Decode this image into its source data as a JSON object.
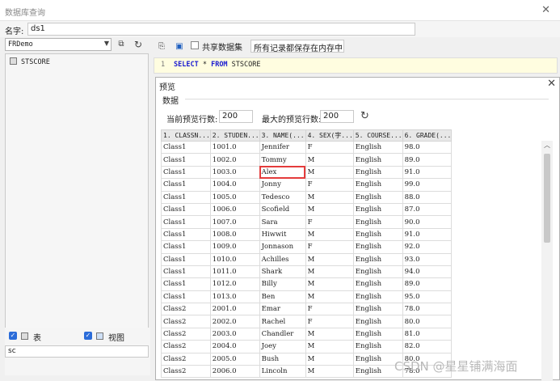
{
  "window": {
    "title": "数据库查询",
    "close": "✕"
  },
  "name_row": {
    "label": "名字:",
    "value": "ds1"
  },
  "left": {
    "db_select": "FRDemo",
    "tables": [
      "STSCORE"
    ],
    "table_checkbox_label": "表",
    "view_checkbox_label": "视图",
    "filter_value": "sc"
  },
  "sql_toolbar": {
    "share_label": "共享数据集",
    "memory_option": "所有记录都保存在内存中"
  },
  "sql": {
    "line_number": "1",
    "keyword_select": "SELECT",
    "star": " * ",
    "keyword_from": "FROM",
    "table": " STSCORE"
  },
  "preview": {
    "title": "预览",
    "tab_label": "数据",
    "row_count_label": "当前预览行数:",
    "row_count_value": "200",
    "max_rows_label": "最大的预览行数:",
    "max_rows_value": "200",
    "columns": [
      "1. CLASSN...",
      "2. STUDEN...",
      "3. NAME(...",
      "4. SEX(字...",
      "5. COURSE...",
      "6. GRADE(..."
    ],
    "rows": [
      [
        "Class1",
        "1001.0",
        "Jennifer",
        "F",
        "English",
        "98.0"
      ],
      [
        "Class1",
        "1002.0",
        "Tommy",
        "M",
        "English",
        "89.0"
      ],
      [
        "Class1",
        "1003.0",
        "Alex",
        "M",
        "English",
        "91.0"
      ],
      [
        "Class1",
        "1004.0",
        "Jonny",
        "F",
        "English",
        "99.0"
      ],
      [
        "Class1",
        "1005.0",
        "Tedesco",
        "M",
        "English",
        "88.0"
      ],
      [
        "Class1",
        "1006.0",
        "Scofield",
        "M",
        "English",
        "87.0"
      ],
      [
        "Class1",
        "1007.0",
        "Sara",
        "F",
        "English",
        "90.0"
      ],
      [
        "Class1",
        "1008.0",
        "Hiwwit",
        "M",
        "English",
        "91.0"
      ],
      [
        "Class1",
        "1009.0",
        "Jonnason",
        "F",
        "English",
        "92.0"
      ],
      [
        "Class1",
        "1010.0",
        "Achilles",
        "M",
        "English",
        "93.0"
      ],
      [
        "Class1",
        "1011.0",
        "Shark",
        "M",
        "English",
        "94.0"
      ],
      [
        "Class1",
        "1012.0",
        "Billy",
        "M",
        "English",
        "89.0"
      ],
      [
        "Class1",
        "1013.0",
        "Ben",
        "M",
        "English",
        "95.0"
      ],
      [
        "Class2",
        "2001.0",
        "Emar",
        "F",
        "English",
        "78.0"
      ],
      [
        "Class2",
        "2002.0",
        "Rachel",
        "F",
        "English",
        "80.0"
      ],
      [
        "Class2",
        "2003.0",
        "Chandler",
        "M",
        "English",
        "81.0"
      ],
      [
        "Class2",
        "2004.0",
        "Joey",
        "M",
        "English",
        "82.0"
      ],
      [
        "Class2",
        "2005.0",
        "Bush",
        "M",
        "English",
        "80.0"
      ],
      [
        "Class2",
        "2006.0",
        "Lincoln",
        "M",
        "English",
        "78.0"
      ]
    ],
    "highlight": {
      "row": 2,
      "col": 2
    }
  },
  "watermark": "CSDN @星星铺满海面"
}
